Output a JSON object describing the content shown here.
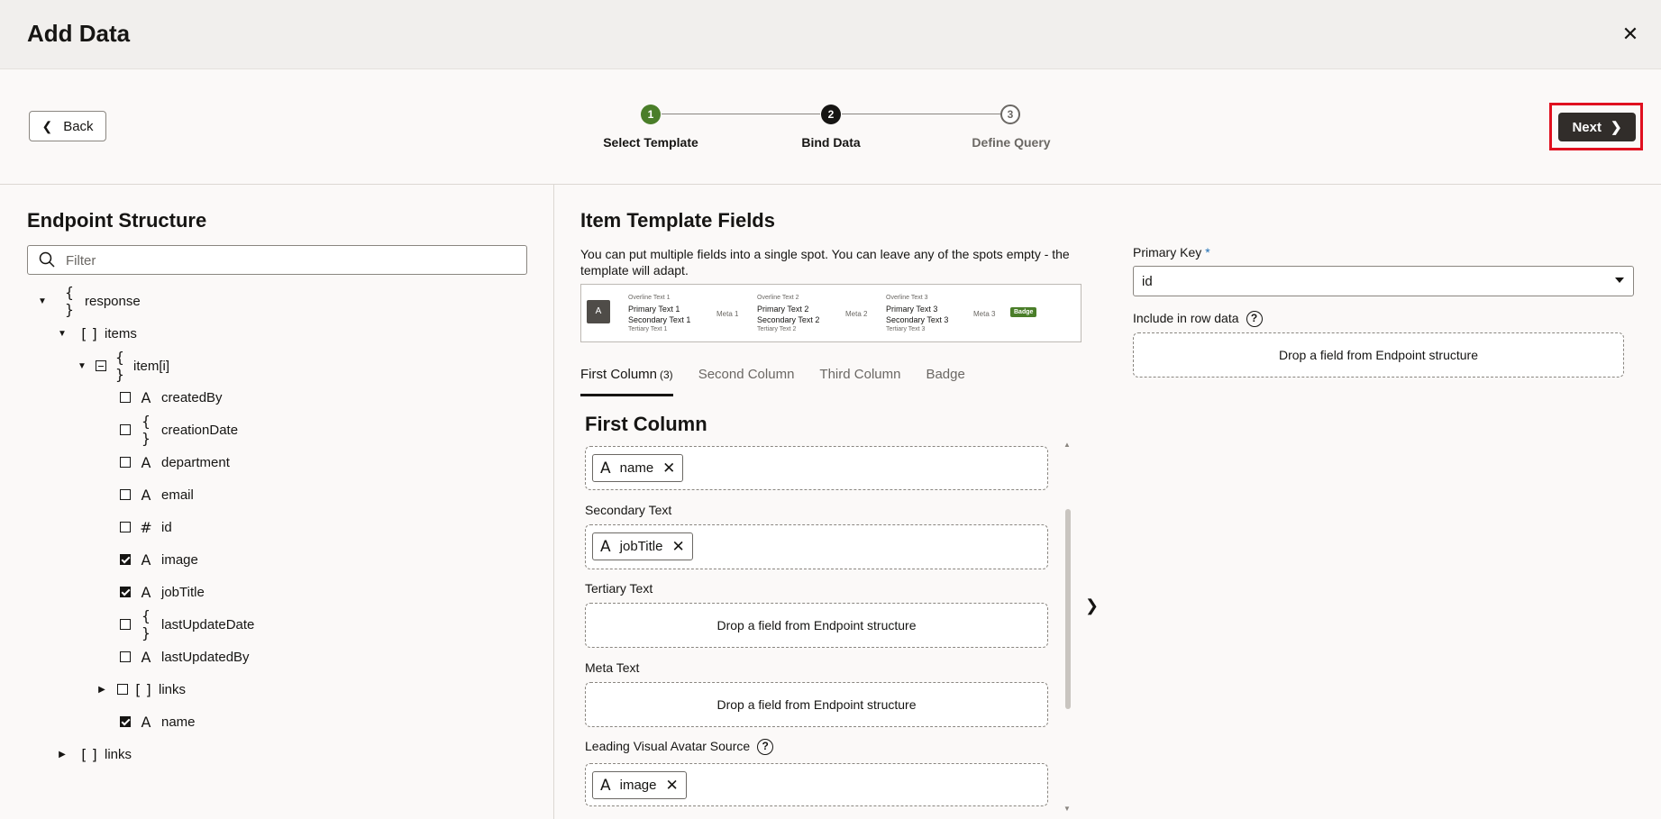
{
  "dialog": {
    "title": "Add Data",
    "close_symbol": "✕"
  },
  "wizard": {
    "back_label": "Back",
    "next_label": "Next",
    "steps": [
      {
        "number": "1",
        "label": "Select Template",
        "state": "done"
      },
      {
        "number": "2",
        "label": "Bind Data",
        "state": "current"
      },
      {
        "number": "3",
        "label": "Define Query",
        "state": "future"
      }
    ]
  },
  "endpoint": {
    "title": "Endpoint Structure",
    "filter_placeholder": "Filter",
    "tree": [
      {
        "label": "response",
        "icon": "{ }",
        "toggle": "▼"
      },
      {
        "label": "items",
        "icon": "[ ]",
        "toggle": "▼"
      },
      {
        "label": "item[i]",
        "icon": "{ }",
        "toggle": "▼"
      },
      {
        "label": "createdBy",
        "icon": "A",
        "checked": false
      },
      {
        "label": "creationDate",
        "icon": "{ }",
        "checked": false
      },
      {
        "label": "department",
        "icon": "A",
        "checked": false
      },
      {
        "label": "email",
        "icon": "A",
        "checked": false
      },
      {
        "label": "id",
        "icon": "#",
        "checked": false
      },
      {
        "label": "image",
        "icon": "A",
        "checked": true
      },
      {
        "label": "jobTitle",
        "icon": "A",
        "checked": true
      },
      {
        "label": "lastUpdateDate",
        "icon": "{ }",
        "checked": false
      },
      {
        "label": "lastUpdatedBy",
        "icon": "A",
        "checked": false
      },
      {
        "label": "links",
        "icon": "[ ]",
        "checked": false,
        "toggle": "▶"
      },
      {
        "label": "name",
        "icon": "A",
        "checked": true
      },
      {
        "label": "links",
        "icon": "[ ]",
        "toggle": "▶"
      }
    ]
  },
  "template": {
    "title": "Item Template Fields",
    "description": "You can put multiple fields into a single spot. You can leave any of the spots empty - the template will adapt.",
    "preview": {
      "avatar": "A",
      "columns": [
        {
          "overline": "Overline Text 1",
          "primary": "Primary Text 1",
          "secondary": "Secondary Text 1",
          "tertiary": "Tertiary Text 1",
          "meta": "Meta 1"
        },
        {
          "overline": "Overline Text 2",
          "primary": "Primary Text 2",
          "secondary": "Secondary Text 2",
          "tertiary": "Tertiary Text 2",
          "meta": "Meta 2"
        },
        {
          "overline": "Overline Text 3",
          "primary": "Primary Text 3",
          "secondary": "Secondary Text 3",
          "tertiary": "Tertiary Text 3",
          "meta": "Meta 3"
        }
      ],
      "badge": "Badge"
    },
    "tabs": [
      {
        "label": "First Column",
        "count": "(3)",
        "active": true
      },
      {
        "label": "Second Column",
        "count": ""
      },
      {
        "label": "Third Column",
        "count": ""
      },
      {
        "label": "Badge",
        "count": ""
      }
    ],
    "section_title": "First Column",
    "fields": {
      "primary_chip": "name",
      "secondary_label": "Secondary Text",
      "secondary_chip": "jobTitle",
      "tertiary_label": "Tertiary Text",
      "tertiary_hint": "Drop a field from Endpoint structure",
      "meta_label": "Meta Text",
      "meta_hint": "Drop a field from Endpoint structure",
      "avatar_label": "Leading Visual Avatar Source",
      "avatar_chip": "image"
    }
  },
  "right": {
    "primary_key_label": "Primary Key",
    "required_mark": "*",
    "primary_key_value": "id",
    "include_label": "Include in row data",
    "include_hint": "Drop a field from Endpoint structure"
  }
}
